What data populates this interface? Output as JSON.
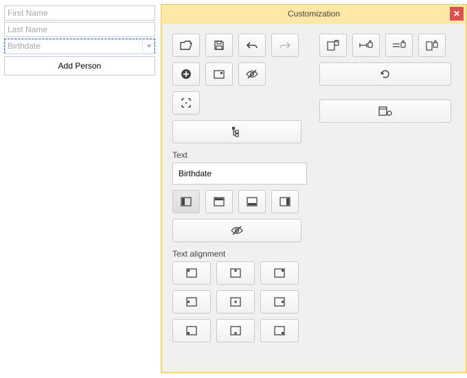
{
  "form": {
    "first_name_ph": "First Name",
    "last_name_ph": "Last Name",
    "birthdate_ph": "Birthdate",
    "add_btn": "Add Person"
  },
  "panel": {
    "title": "Customization",
    "section_text": "Text",
    "text_value": "Birthdate",
    "section_align": "Text alignment"
  }
}
